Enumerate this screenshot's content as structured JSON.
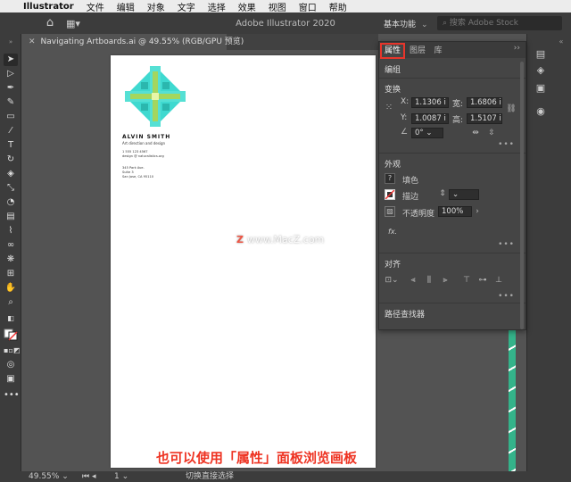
{
  "menubar": {
    "app": "Illustrator",
    "items": [
      "文件",
      "编辑",
      "对象",
      "文字",
      "选择",
      "效果",
      "视图",
      "窗口",
      "帮助"
    ]
  },
  "appbar": {
    "title": "Adobe Illustrator 2020",
    "preset": "基本功能",
    "search_placeholder": "搜索 Adobe Stock"
  },
  "document_tab": {
    "label": "Navigating Artboards.ai @ 49.55% (RGB/GPU 预览)"
  },
  "artboard": {
    "name": "ALVIN SMITH",
    "role": "Art direction and design",
    "phone": "1 555 123 4567",
    "email": "design @ naturalistics.org",
    "address_line1": "345 Park Ave.",
    "address_line2": "Suite 3",
    "address_line3": "San Jose, CA 95110"
  },
  "watermark": {
    "brand": "Z",
    "text": "www.MacZ.com"
  },
  "panel": {
    "tabs": [
      "属性",
      "图层",
      "库"
    ],
    "active_tab": "属性",
    "group_label": "编组",
    "transform": {
      "title": "变换",
      "x_label": "X:",
      "x_value": "1.1306 i",
      "y_label": "Y:",
      "y_value": "1.0087 i",
      "w_label": "宽:",
      "w_value": "1.6806 ir",
      "h_label": "高:",
      "h_value": "1.5107 ir",
      "angle_value": "0°"
    },
    "appearance": {
      "title": "外观",
      "fill_label": "填色",
      "stroke_label": "描边",
      "opacity_label": "不透明度",
      "opacity_value": "100%",
      "fx_label": "fx."
    },
    "align": {
      "title": "对齐"
    },
    "pathfinder": {
      "title": "路径查找器"
    }
  },
  "statusbar": {
    "zoom": "49.55%",
    "page": "1",
    "status": "切换直接选择"
  },
  "caption": "也可以使用「属性」面板浏览画板",
  "colors": {
    "accent_red": "#e8352b",
    "logo_teal": "#3fd9d0",
    "logo_green": "#a4d65e",
    "stripe_green": "#34b38a"
  }
}
